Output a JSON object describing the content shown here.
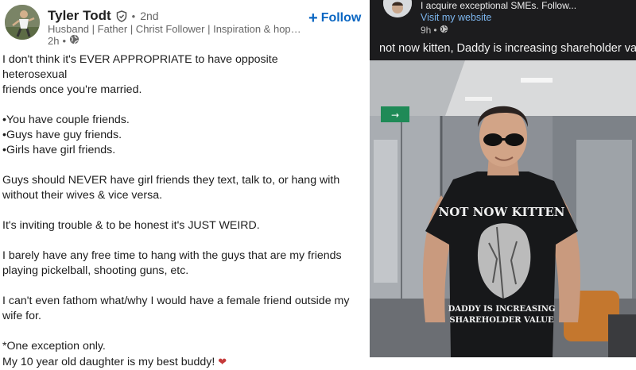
{
  "left_post": {
    "author_name": "Tyler Todt",
    "connection_degree": "2nd",
    "headline": "Husband | Father | Christ Follower | Inspiration & hope for ...",
    "time": "2h",
    "follow_label": "Follow",
    "paragraphs": [
      "I don't think it's EVER APPROPRIATE to have opposite        heterosexual\nfriends once you're married.",
      "•You have couple friends.\n•Guys have guy friends.\n•Girls have girl friends.",
      "Guys should NEVER have girl friends they text, talk to, or hang with\nwithout their wives & vice versa.",
      "It's inviting trouble & to be honest it's JUST WEIRD.",
      "I barely have any free time to hang with the guys that are my friends\nplaying pickelball, shooting guns, etc.",
      "I can't even fathom what/why I would have a female friend outside my\nwife for.",
      "*One exception only.\nMy 10 year old daughter is my best buddy! "
    ],
    "heart_glyph": "❤"
  },
  "right_post": {
    "tagline": "I acquire exceptional SMEs. Follow...",
    "website_link": "Visit my website",
    "time": "9h",
    "caption": "not now kitten, Daddy is increasing shareholder value",
    "photo": {
      "sign_text": "→",
      "shirt_text_top": "NOT NOW KITTEN",
      "shirt_text_bottom_1": "DADDY IS INCREASING",
      "shirt_text_bottom_2": "SHAREHOLDER VALUE"
    }
  },
  "colors": {
    "accent_blue": "#0a66c2",
    "link_blue": "#7db6ee",
    "dark_bg": "#1c1c1e",
    "heart_red": "#c53a3a"
  },
  "icons": [
    "verified-shield-icon",
    "globe-icon"
  ]
}
